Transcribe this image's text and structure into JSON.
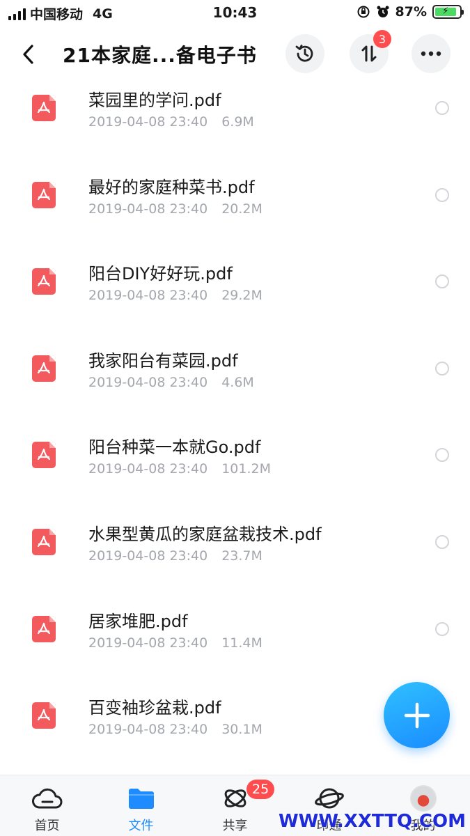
{
  "status_bar": {
    "carrier": "中国移动",
    "network": "4G",
    "time": "10:43",
    "battery": "87%"
  },
  "nav": {
    "title": "21本家庭...备电子书",
    "transfer_badge": "3"
  },
  "files": [
    {
      "name": "菜园里的学问.pdf",
      "date": "2019-04-08 23:40",
      "size": "6.9M"
    },
    {
      "name": "最好的家庭种菜书.pdf",
      "date": "2019-04-08 23:40",
      "size": "20.2M"
    },
    {
      "name": "阳台DIY好好玩.pdf",
      "date": "2019-04-08 23:40",
      "size": "29.2M"
    },
    {
      "name": "我家阳台有菜园.pdf",
      "date": "2019-04-08 23:40",
      "size": "4.6M"
    },
    {
      "name": "阳台种菜一本就Go.pdf",
      "date": "2019-04-08 23:40",
      "size": "101.2M"
    },
    {
      "name": "水果型黄瓜的家庭盆栽技术.pdf",
      "date": "2019-04-08 23:40",
      "size": "23.7M"
    },
    {
      "name": "居家堆肥.pdf",
      "date": "2019-04-08 23:40",
      "size": "11.4M"
    },
    {
      "name": "百变袖珍盆栽.pdf",
      "date": "2019-04-08 23:40",
      "size": "30.1M"
    }
  ],
  "tabs": [
    {
      "label": "首页"
    },
    {
      "label": "文件"
    },
    {
      "label": "共享",
      "badge": "25"
    },
    {
      "label": "印通"
    },
    {
      "label": "我的"
    }
  ],
  "watermark": "WWW.XXTTQ.COM",
  "colors": {
    "accent": "#1e8bff",
    "pdf_red": "#f25a5e",
    "badge_red": "#ff4d4f"
  }
}
